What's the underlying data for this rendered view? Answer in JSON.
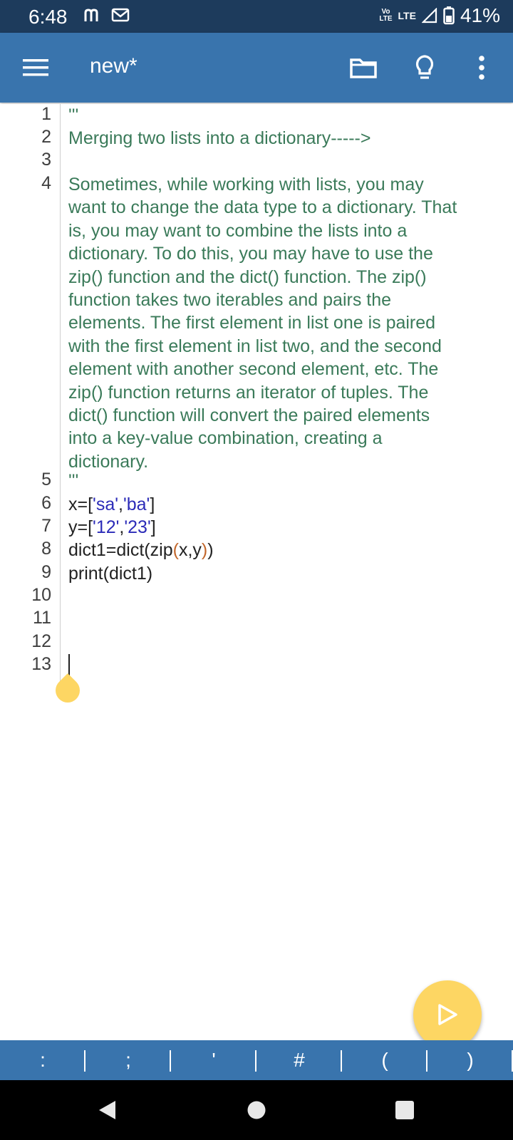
{
  "status_bar": {
    "time": "6:48",
    "volte_top": "Vo",
    "volte_bottom": "LTE",
    "network": "LTE",
    "battery": "41%"
  },
  "toolbar": {
    "title": "new*",
    "icons": [
      "menu-icon",
      "folder-icon",
      "lightbulb-icon",
      "more-vert-icon"
    ]
  },
  "editor": {
    "line_numbers": [
      "1",
      "2",
      "3",
      "4",
      "5",
      "6",
      "7",
      "8",
      "9",
      "10",
      "11",
      "12",
      "13"
    ],
    "line1": "'''",
    "line2": "Merging two lists into a dictionary----->",
    "line4": [
      "Sometimes, while working with lists, you may",
      "want to change the data type to a dictionary. That",
      "is, you may want to combine the lists into a",
      "dictionary. To do this, you may have to use the",
      "zip() function and the dict() function. The zip()",
      "function takes two iterables and pairs the",
      "elements. The first element in list one is paired",
      "with the first element in list two, and the second",
      "element with another second element, etc. The",
      "zip() function returns an iterator of tuples. The",
      "dict() function will convert the paired elements",
      "into a key-value combination, creating a",
      "dictionary."
    ],
    "line5": "'''",
    "line6": {
      "a": "x=[",
      "b": "'sa'",
      "c": ",",
      "d": "'ba'",
      "e": "]"
    },
    "line7": {
      "a": "y=[",
      "b": "'12'",
      "c": ",",
      "d": "'23'",
      "e": "]"
    },
    "line8": {
      "a": "dict1=dict(zip",
      "b": "(",
      "c": "x,y",
      "d": ")",
      "e": ")"
    },
    "line9": "print(dict1)"
  },
  "symbol_bar": [
    ":",
    ";",
    "'",
    "#",
    "(",
    ")"
  ],
  "colors": {
    "status_bar": "#1d3b5c",
    "toolbar": "#3974ad",
    "comment": "#3a7a59",
    "string": "#2b2bb8",
    "accent": "#fdd663"
  }
}
